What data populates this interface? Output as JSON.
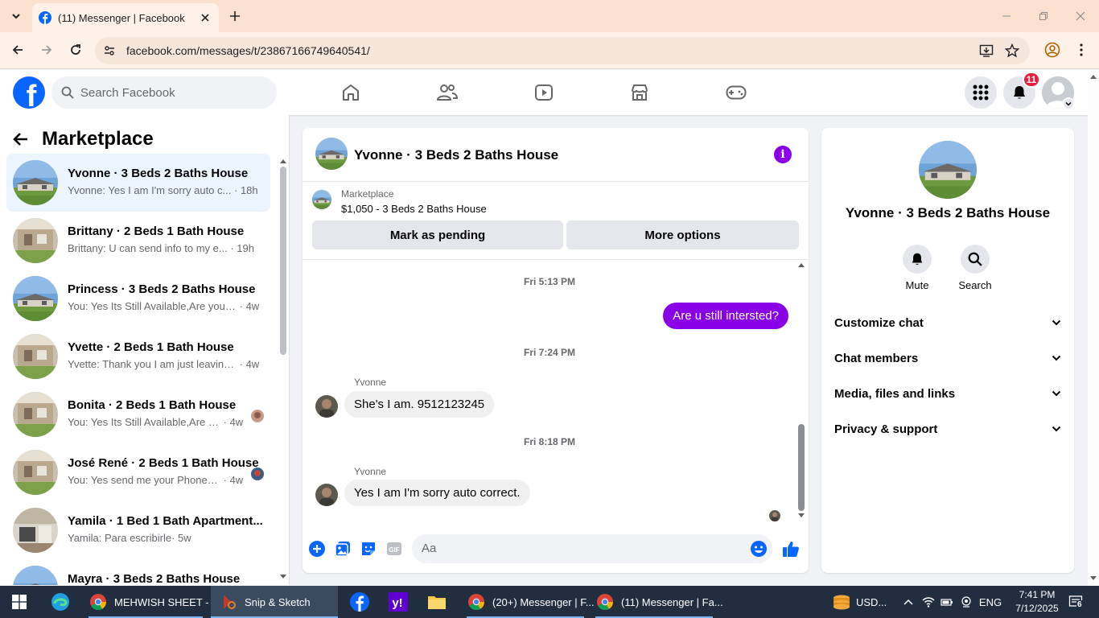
{
  "browser": {
    "tab_title": "(11) Messenger | Facebook",
    "url": "facebook.com/messages/t/23867166749640541/"
  },
  "fb": {
    "search_placeholder": "Search Facebook",
    "notification_count": "11"
  },
  "sidebar": {
    "title": "Marketplace",
    "conversations": [
      {
        "title": "Yvonne · 3 Beds 2 Baths House",
        "snippet": "Yvonne: Yes I am I'm sorry auto c...",
        "time": "· 18h",
        "active": true
      },
      {
        "title": "Brittany · 2 Beds 1 Bath House",
        "snippet": "Brittany: U can send info to my e...",
        "time": "· 19h"
      },
      {
        "title": "Princess · 3 Beds 2 Baths House",
        "snippet": "You: Yes Its Still Available,Are you i...",
        "time": "· 4w"
      },
      {
        "title": "Yvette · 2 Beds 1 Bath House",
        "snippet": "Yvette: Thank you I am just leaving...",
        "time": "· 4w"
      },
      {
        "title": "Bonita · 2 Beds 1 Bath House",
        "snippet": "You: Yes Its Still Available,Are yo...",
        "time": "· 4w"
      },
      {
        "title": "José René · 2 Beds 1 Bath House",
        "snippet": "You: Yes send me your Phone N...",
        "time": "· 4w"
      },
      {
        "title": "Yamila · 1 Bed 1 Bath Apartment...",
        "snippet": "Yamila: Para escribirle",
        "time": "· 5w"
      },
      {
        "title": "Mayra · 3 Beds 2 Baths House",
        "snippet": "",
        "time": ""
      }
    ]
  },
  "chat": {
    "title": "Yvonne · 3 Beds 2 Baths House",
    "marketplace_label": "Marketplace",
    "listing": "$1,050 - 3 Beds 2 Baths House",
    "mark_pending": "Mark as pending",
    "more_options": "More options",
    "messages": {
      "ts1": "Fri 5:13 PM",
      "out1": "Are u still intersted?",
      "ts2": "Fri 7:24 PM",
      "sender2": "Yvonne",
      "in2": "She's I am. 9512123245",
      "ts3": "Fri 8:18 PM",
      "sender3": "Yvonne",
      "in3": "Yes I am I'm sorry auto correct."
    },
    "composer_placeholder": "Aa",
    "accent_color": "#8a00e6"
  },
  "info_panel": {
    "name": "Yvonne · 3 Beds 2 Baths House",
    "mute": "Mute",
    "search": "Search",
    "rows": [
      "Customize chat",
      "Chat members",
      "Media, files and links",
      "Privacy & support"
    ]
  },
  "taskbar": {
    "items": [
      "MEHWISH SHEET - ...",
      "Snip & Sketch",
      "(20+) Messenger | F...",
      "(11) Messenger | Fa..."
    ],
    "currency": "USD...",
    "language": "ENG",
    "time": "7:41 PM",
    "date": "7/12/2025",
    "notif_count": "6"
  }
}
